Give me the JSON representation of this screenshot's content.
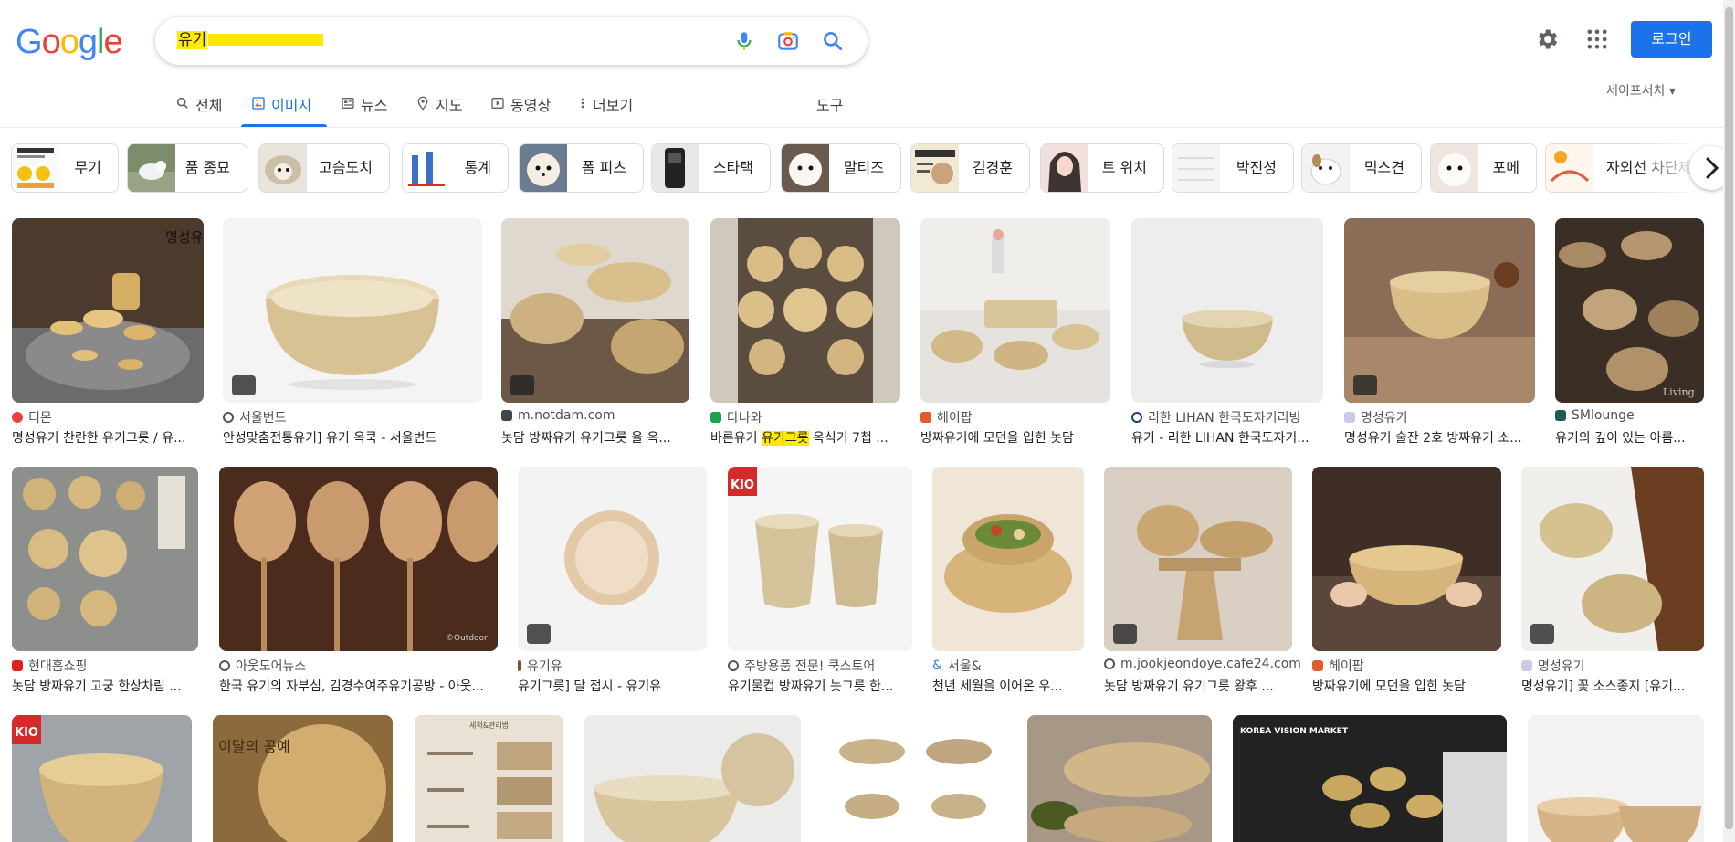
{
  "header": {
    "logo_letters": [
      "G",
      "o",
      "o",
      "g",
      "l",
      "e"
    ],
    "logo_colors": [
      "#4285f4",
      "#ea4335",
      "#fbbc05",
      "#4285f4",
      "#34a853",
      "#ea4335"
    ],
    "query_text": "유기",
    "login_label": "로그인"
  },
  "tabs": [
    {
      "label": "전체",
      "icon": "search-icon"
    },
    {
      "label": "이미지",
      "icon": "image-icon",
      "active": true
    },
    {
      "label": "뉴스",
      "icon": "news-icon"
    },
    {
      "label": "지도",
      "icon": "map-pin-icon"
    },
    {
      "label": "동영상",
      "icon": "play-icon"
    },
    {
      "label": "더보기",
      "icon": "more-vert-icon"
    }
  ],
  "tools_label": "도구",
  "safesearch_label": "세이프서치 ▾",
  "chips": [
    "무기",
    "품 종묘",
    "고슴도치",
    "통계",
    "폼 피츠",
    "스타택",
    "말티즈",
    "김경훈",
    "트 위치",
    "박진성",
    "믹스견",
    "포메",
    "자외선 차단제"
  ],
  "colors": {
    "accent": "#1a73e8",
    "highlight": "#ffea00"
  },
  "results": [
    {
      "source": "티몬",
      "title": "명성유기 찬란한 유기그릇 / 유...",
      "tag": false
    },
    {
      "source": "서울번드",
      "title": "안성맞춤전통유기] 유기 옥쿡 - 서울번드",
      "tag": true
    },
    {
      "source": "m.notdam.com",
      "title": "놋담 방짜유기 유기그릇 율 옥...",
      "tag": true
    },
    {
      "source": "다나와",
      "title_pre": "바른유기 ",
      "title_hl": "유기그릇",
      "title_post": " 옥식기 7첩 ...",
      "tag": false
    },
    {
      "source": "헤이팝",
      "title": "방짜유기에 모던을 입힌 놋담",
      "tag": false
    },
    {
      "source": "리한 LIHAN 한국도자기리빙",
      "title": "유기 - 리한 LIHAN 한국도자기...",
      "tag": false
    },
    {
      "source": "명성유기",
      "title": "명성유기 술잔 2호 방짜유기 소...",
      "tag": true
    },
    {
      "source": "SMlounge",
      "title": "유기의 깊이 있는 아름...",
      "tag": false
    },
    {
      "source": "현대홈쇼핑",
      "title": "놋담 방짜유기 고궁 한상차림 ...",
      "tag": false
    },
    {
      "source": "아웃도어뉴스",
      "title": "한국 유기의 자부심, 김경수여주유기공방 - 아웃...",
      "tag": false
    },
    {
      "source": "유기유",
      "title": "유기그릇] 달 접시 - 유기유",
      "tag": true
    },
    {
      "source": "주방용품 전문! 쿡스토어",
      "title": "유기물컵 방짜유기 놋그릇 한...",
      "tag": false
    },
    {
      "source": "서울&",
      "title": "천년 세월을 이어온 우...",
      "tag": false
    },
    {
      "source": "m.jookjeondoye.cafe24.com",
      "title": "놋담 방짜유기 유기그릇 왕후 ...",
      "tag": true
    },
    {
      "source": "헤이팝",
      "title": "방짜유기에 모던을 입힌 놋담",
      "tag": false
    },
    {
      "source": "명성유기",
      "title": "명성유기] 꽃 소스종지 [유기...",
      "tag": true
    }
  ],
  "image_text": {
    "img1": "명성유기",
    "img8": "Living",
    "img10": "©Outdoor",
    "img12": "KIO",
    "row3_kio": "KIO",
    "row3_gong": "이달의 공예",
    "row3_guide": "세척&관리법",
    "row3_market": "KOREA VISION MARKET"
  }
}
